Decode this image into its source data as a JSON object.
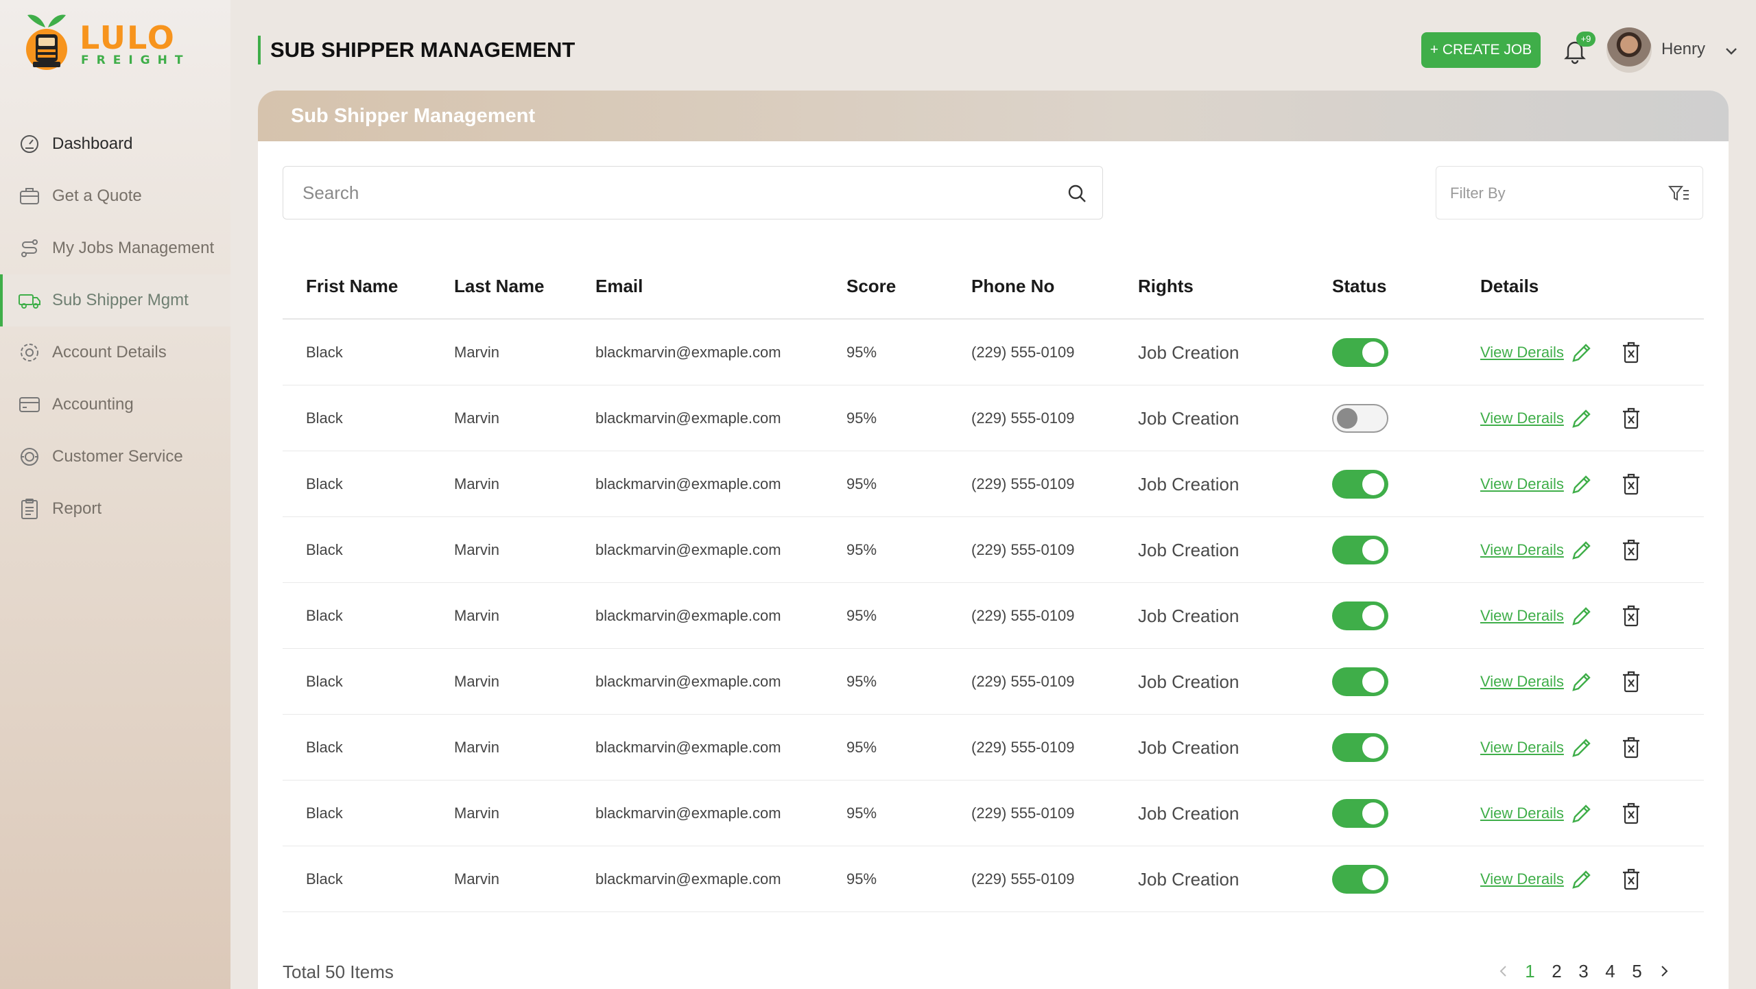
{
  "brand": {
    "name": "LULO",
    "tagline": "FREIGHT"
  },
  "sidebar": {
    "items": [
      {
        "label": "Dashboard",
        "icon": "gauge-icon"
      },
      {
        "label": "Get a Quote",
        "icon": "briefcase-icon"
      },
      {
        "label": "My Jobs Management",
        "icon": "route-icon"
      },
      {
        "label": "Sub Shipper Mgmt",
        "icon": "truck-icon",
        "active": true
      },
      {
        "label": "Account Details",
        "icon": "gear-icon"
      },
      {
        "label": "Accounting",
        "icon": "card-icon"
      },
      {
        "label": "Customer Service",
        "icon": "headset-icon"
      },
      {
        "label": "Report",
        "icon": "clipboard-icon"
      }
    ]
  },
  "header": {
    "title": "SUB SHIPPER MANAGEMENT",
    "create_label": "+ CREATE JOB",
    "notification_count": "+9",
    "user_name": "Henry"
  },
  "panel": {
    "title": "Sub Shipper Management",
    "search_placeholder": "Search",
    "filter_label": "Filter By"
  },
  "table": {
    "columns": [
      "Frist Name",
      "Last Name",
      "Email",
      "Score",
      "Phone No",
      "Rights",
      "Status",
      "Details"
    ],
    "view_label": "View Derails",
    "rows": [
      {
        "first": "Black",
        "last": "Marvin",
        "email": "blackmarvin@exmaple.com",
        "score": "95%",
        "phone": "(229) 555-0109",
        "rights": "Job Creation",
        "status": true
      },
      {
        "first": "Black",
        "last": "Marvin",
        "email": "blackmarvin@exmaple.com",
        "score": "95%",
        "phone": "(229) 555-0109",
        "rights": "Job Creation",
        "status": false
      },
      {
        "first": "Black",
        "last": "Marvin",
        "email": "blackmarvin@exmaple.com",
        "score": "95%",
        "phone": "(229) 555-0109",
        "rights": "Job Creation",
        "status": true
      },
      {
        "first": "Black",
        "last": "Marvin",
        "email": "blackmarvin@exmaple.com",
        "score": "95%",
        "phone": "(229) 555-0109",
        "rights": "Job Creation",
        "status": true
      },
      {
        "first": "Black",
        "last": "Marvin",
        "email": "blackmarvin@exmaple.com",
        "score": "95%",
        "phone": "(229) 555-0109",
        "rights": "Job Creation",
        "status": true
      },
      {
        "first": "Black",
        "last": "Marvin",
        "email": "blackmarvin@exmaple.com",
        "score": "95%",
        "phone": "(229) 555-0109",
        "rights": "Job Creation",
        "status": true
      },
      {
        "first": "Black",
        "last": "Marvin",
        "email": "blackmarvin@exmaple.com",
        "score": "95%",
        "phone": "(229) 555-0109",
        "rights": "Job Creation",
        "status": true
      },
      {
        "first": "Black",
        "last": "Marvin",
        "email": "blackmarvin@exmaple.com",
        "score": "95%",
        "phone": "(229) 555-0109",
        "rights": "Job Creation",
        "status": true
      },
      {
        "first": "Black",
        "last": "Marvin",
        "email": "blackmarvin@exmaple.com",
        "score": "95%",
        "phone": "(229) 555-0109",
        "rights": "Job Creation",
        "status": true
      }
    ]
  },
  "footer": {
    "total": "Total 50 Items",
    "pages": [
      "1",
      "2",
      "3",
      "4",
      "5"
    ],
    "current_page": "1"
  },
  "colors": {
    "accent": "#3fae49",
    "brand_orange": "#f7941d"
  }
}
